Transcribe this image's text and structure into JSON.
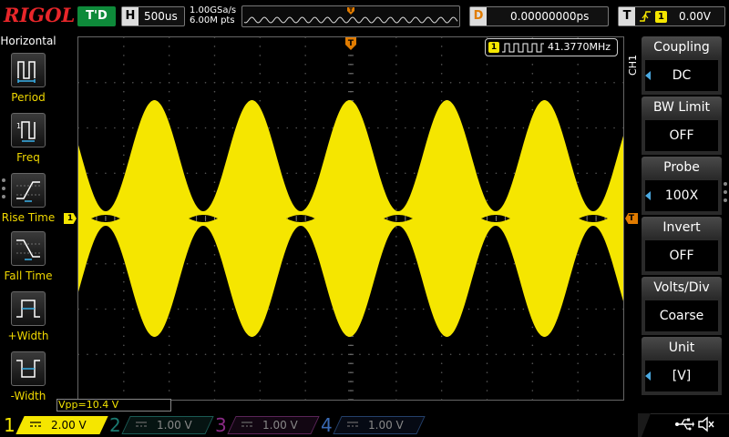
{
  "brand": {
    "logo": "RIGOL"
  },
  "top": {
    "run_status": "T'D",
    "horizontal": {
      "letter": "H",
      "value": "500us"
    },
    "sample_rate": "1.00GSa/s",
    "memory_depth": "6.00M pts",
    "delay": {
      "letter": "D",
      "value": "0.00000000ps"
    },
    "trigger": {
      "letter": "T",
      "source": "1",
      "level": "0.00V",
      "edge": "rising-edge-icon"
    }
  },
  "left_panel": {
    "title": "Horizontal",
    "measurements": [
      {
        "label": "Period",
        "icon": "period-icon"
      },
      {
        "label": "Freq",
        "icon": "frequency-icon"
      },
      {
        "label": "Rise Time",
        "icon": "rise-time-icon"
      },
      {
        "label": "Fall Time",
        "icon": "fall-time-icon"
      },
      {
        "label": "+Width",
        "icon": "positive-width-icon"
      },
      {
        "label": "-Width",
        "icon": "negative-width-icon"
      }
    ]
  },
  "screen": {
    "channel_marker": "1",
    "trigger_marker": "T",
    "frequency_counter": {
      "channel": "1",
      "value": "41.3770MHz"
    },
    "waveform_color": "#f5e600"
  },
  "right_menu": {
    "channel_tab": "CH1",
    "items": [
      {
        "title": "Coupling",
        "value": "DC",
        "has_arrow": true
      },
      {
        "title": "BW Limit",
        "value": "OFF",
        "has_arrow": false
      },
      {
        "title": "Probe",
        "value": "100X",
        "has_arrow": true
      },
      {
        "title": "Invert",
        "value": "OFF",
        "has_arrow": false
      },
      {
        "title": "Volts/Div",
        "value": "Coarse",
        "has_arrow": false
      },
      {
        "title": "Unit",
        "value": "[V]",
        "has_arrow": true
      }
    ]
  },
  "measurement_readout": "Vpp=10.4 V",
  "channels": [
    {
      "number": "1",
      "scale": "2.00 V",
      "color": "#f5e600",
      "active": true
    },
    {
      "number": "2",
      "scale": "1.00 V",
      "color": "#1a9a8a",
      "active": false
    },
    {
      "number": "3",
      "scale": "1.00 V",
      "color": "#a0329a",
      "active": false
    },
    {
      "number": "4",
      "scale": "1.00 V",
      "color": "#3a6ab4",
      "active": false
    }
  ]
}
